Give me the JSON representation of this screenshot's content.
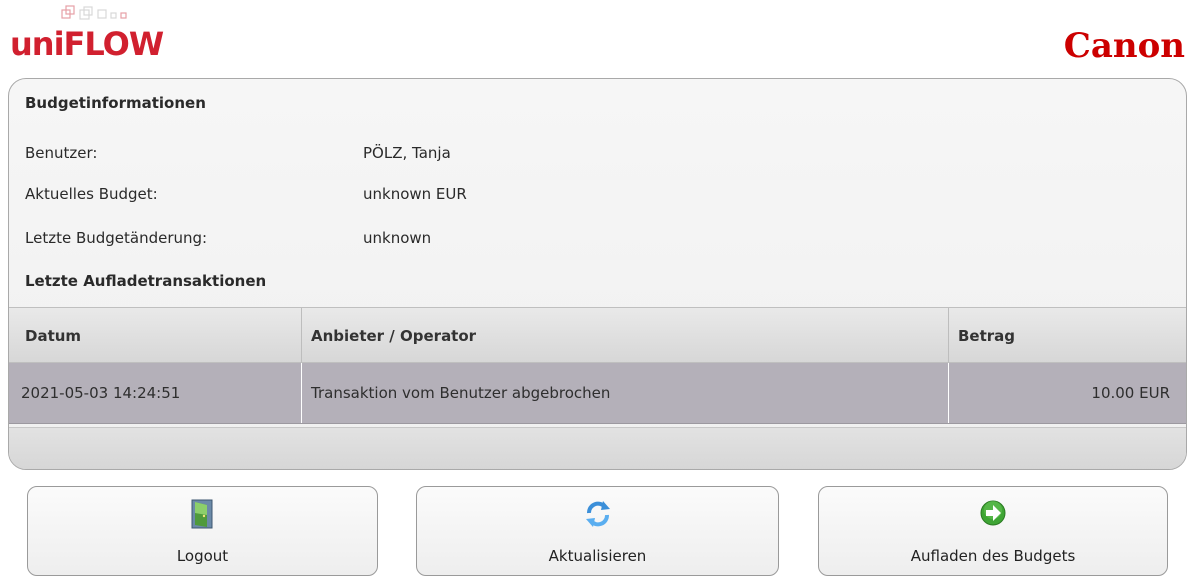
{
  "header": {
    "brand_uni": "uni",
    "brand_flow": "FLOW",
    "canon": "Canon"
  },
  "budget": {
    "title": "Budgetinformationen",
    "rows": [
      {
        "label": "Benutzer:",
        "value": "PÖLZ, Tanja"
      },
      {
        "label": "Aktuelles Budget:",
        "value": "unknown EUR"
      },
      {
        "label": "Letzte Budgetänderung:",
        "value": "unknown"
      }
    ]
  },
  "transactions": {
    "title": "Letzte Aufladetransaktionen",
    "columns": [
      "Datum",
      "Anbieter / Operator",
      "Betrag"
    ],
    "rows": [
      {
        "date": "2021-05-03 14:24:51",
        "operator": "Transaktion vom Benutzer abgebrochen",
        "amount": "10.00 EUR"
      }
    ]
  },
  "buttons": {
    "logout": {
      "label": "Logout",
      "icon": "door-exit-icon"
    },
    "refresh": {
      "label": "Aktualisieren",
      "icon": "refresh-arrows-icon"
    },
    "topup": {
      "label": "Aufladen des Budgets",
      "icon": "green-arrow-right-icon"
    }
  },
  "colors": {
    "brand_red": "#d1202f",
    "canon_red": "#cc0000",
    "row_highlight": "#b4b0b9"
  }
}
